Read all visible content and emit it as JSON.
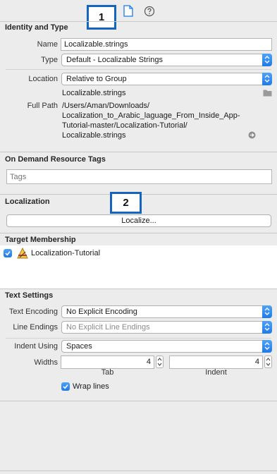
{
  "annotations": {
    "callout_1": "1",
    "callout_2": "2"
  },
  "icons": {
    "file_inspector": "document-icon",
    "quick_help": "question-circle-icon",
    "folder": "folder-icon",
    "reveal": "arrow-circle-icon",
    "target": "app-target-icon"
  },
  "identity": {
    "title": "Identity and Type",
    "name_label": "Name",
    "name_value": "Localizable.strings",
    "type_label": "Type",
    "type_value": "Default - Localizable Strings",
    "location_label": "Location",
    "location_value": "Relative to Group",
    "location_file": "Localizable.strings",
    "full_path_label": "Full Path",
    "full_path_lines": [
      "/Users/Aman/Downloads/",
      "Localization_to_Arabic_laguage_From_Inside_App-",
      "Tutorial-master/Localization-Tutorial/",
      "Localizable.strings"
    ]
  },
  "on_demand": {
    "title": "On Demand Resource Tags",
    "tags_placeholder": "Tags"
  },
  "localization": {
    "title": "Localization",
    "button_label": "Localize..."
  },
  "target_membership": {
    "title": "Target Membership",
    "targets": [
      {
        "label": "Localization-Tutorial",
        "checked": true
      }
    ]
  },
  "text_settings": {
    "title": "Text Settings",
    "encoding_label": "Text Encoding",
    "encoding_value": "No Explicit Encoding",
    "line_endings_label": "Line Endings",
    "line_endings_value": "No Explicit Line Endings",
    "indent_using_label": "Indent Using",
    "indent_using_value": "Spaces",
    "widths_label": "Widths",
    "tab_value": "4",
    "tab_label": "Tab",
    "indent_value": "4",
    "indent_label": "Indent",
    "wrap_lines_label": "Wrap lines",
    "wrap_lines_checked": true
  },
  "colors": {
    "accent": "#1f7ae8",
    "callout_border": "#1565c0",
    "panel_bg": "#ececec"
  }
}
